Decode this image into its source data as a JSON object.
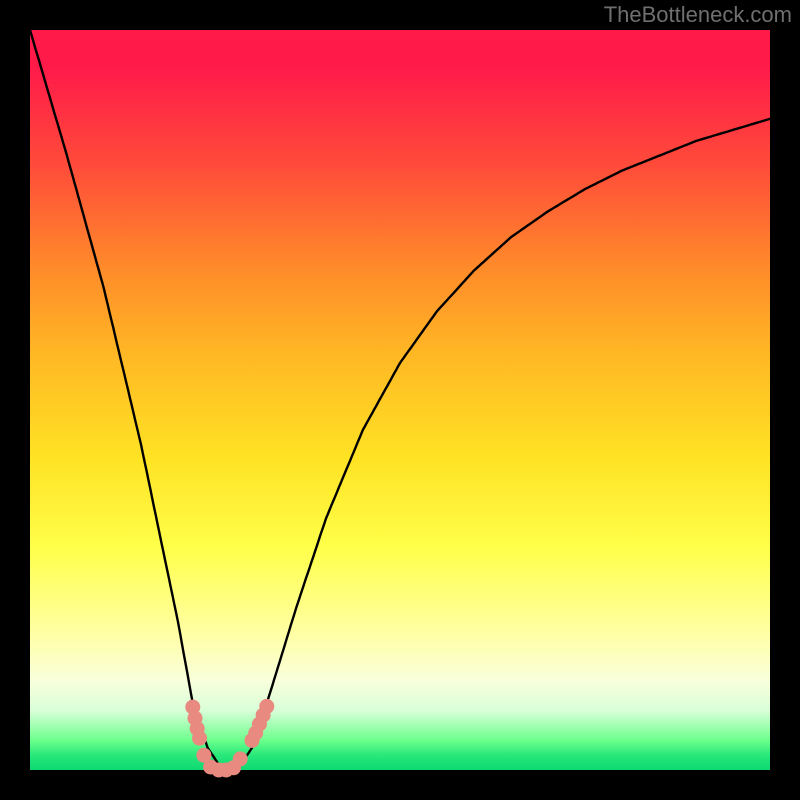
{
  "attribution": "TheBottleneck.com",
  "chart_data": {
    "type": "line",
    "title": "",
    "xlabel": "",
    "ylabel": "",
    "xlim": [
      0,
      100
    ],
    "ylim": [
      0,
      100
    ],
    "grid": false,
    "series": [
      {
        "name": "bottleneck-curve",
        "x": [
          0,
          5,
          10,
          15,
          20,
          22,
          24,
          26,
          28,
          30,
          32,
          36,
          40,
          45,
          50,
          55,
          60,
          65,
          70,
          75,
          80,
          85,
          90,
          95,
          100
        ],
        "values": [
          100,
          83,
          65,
          44,
          20,
          9,
          3,
          0,
          0,
          3,
          9,
          22,
          34,
          46,
          55,
          62,
          67.5,
          72,
          75.5,
          78.5,
          81,
          83,
          85,
          86.5,
          88
        ]
      }
    ],
    "markers": {
      "name": "highlighted-points",
      "color": "#e88a80",
      "points": [
        {
          "x": 22.0,
          "y": 8.5
        },
        {
          "x": 22.3,
          "y": 7.0
        },
        {
          "x": 22.6,
          "y": 5.6
        },
        {
          "x": 22.9,
          "y": 4.3
        },
        {
          "x": 23.5,
          "y": 2.0
        },
        {
          "x": 24.4,
          "y": 0.4
        },
        {
          "x": 25.5,
          "y": 0.0
        },
        {
          "x": 26.5,
          "y": 0.0
        },
        {
          "x": 27.5,
          "y": 0.3
        },
        {
          "x": 28.4,
          "y": 1.5
        },
        {
          "x": 30.0,
          "y": 4.0
        },
        {
          "x": 30.5,
          "y": 5.0
        },
        {
          "x": 31.0,
          "y": 6.2
        },
        {
          "x": 31.5,
          "y": 7.4
        },
        {
          "x": 32.0,
          "y": 8.6
        }
      ]
    }
  }
}
